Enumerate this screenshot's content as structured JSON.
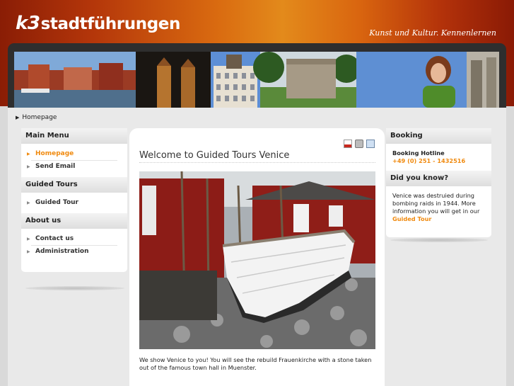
{
  "header": {
    "logo_mark": "k3",
    "logo_text": "stadtführungen",
    "tagline": "Kunst und Kultur. Kennenlernen"
  },
  "breadcrumb": {
    "item": "Homepage"
  },
  "menus": [
    {
      "title": "Main Menu",
      "items": [
        {
          "label": "Homepage",
          "active": true
        },
        {
          "label": "Send Email",
          "active": false
        }
      ]
    },
    {
      "title": "Guided Tours",
      "items": [
        {
          "label": "Guided Tour",
          "active": false
        }
      ]
    },
    {
      "title": "About us",
      "items": [
        {
          "label": "Contact us",
          "active": false
        },
        {
          "label": "Administration",
          "active": false
        }
      ]
    }
  ],
  "main": {
    "title": "Welcome to Guided Tours Venice",
    "text": "We show Venice to you! You will see the rebuild Frauenkirche with a stone taken out of the famous town hall in Muenster.",
    "icons": [
      "pdf-icon",
      "print-icon",
      "email-icon"
    ]
  },
  "sidebar": {
    "booking_title": "Booking",
    "hotline_label": "Booking Hotline",
    "hotline_number": "+49 (0) 251 - 1432516",
    "didyouknow_title": "Did you know?",
    "didyouknow_text": "Venice was destruied during bombing raids in 1944. More information you will get in our",
    "didyouknow_link": "Guided Tour"
  },
  "colors": {
    "accent": "#f08a0f",
    "header_dark": "#8a1d05",
    "header_light": "#e38a1b"
  }
}
